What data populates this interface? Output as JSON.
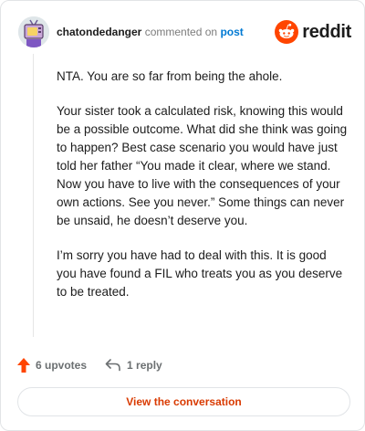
{
  "header": {
    "author": "chatondedanger",
    "action": "commented on",
    "link_label": "post",
    "brand": "reddit"
  },
  "comment": {
    "paragraphs": [
      "NTA. You are so far from being the ahole.",
      "Your sister took a calculated risk, knowing this would be a possible outcome. What did she think was going to happen? Best case scenario you would have just told her father “You made it clear, where we stand. Now you have to live with the consequences of your own actions. See you never.” Some things can never be unsaid, he doesn’t deserve you.",
      "I’m sorry you have had to deal with this. It is good you have found a FIL who treats you as you deserve to be treated."
    ]
  },
  "footer": {
    "upvotes": "6 upvotes",
    "replies": "1 reply"
  },
  "cta": {
    "label": "View the conversation"
  },
  "colors": {
    "brand_orange": "#ff4500",
    "link_blue": "#0079d3",
    "cta_text": "#d93a00"
  },
  "icons": {
    "avatar": "tv-robot-avatar",
    "brand": "snoo-icon",
    "upvote": "upvote-arrow-icon",
    "reply": "reply-arrow-icon"
  }
}
